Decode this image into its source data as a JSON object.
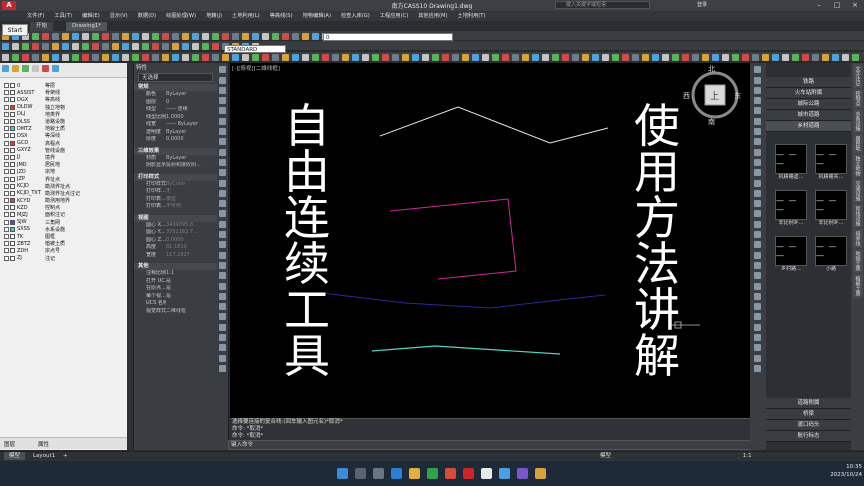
{
  "titlebar": {
    "title": "南方CASS10    Drawing1.dwg",
    "search_placeholder": "键入关键字或短语",
    "user": "登录"
  },
  "start_tooltip": "Start",
  "menu": [
    "文件(F)",
    "工具(T)",
    "编辑(E)",
    "显示(V)",
    "数据(D)",
    "绘图处理(W)",
    "地籍(J)",
    "土地利用(L)",
    "等高线(S)",
    "地物编辑(A)",
    "检查入库(G)",
    "工程应用(C)",
    "其他应用(M)",
    "土地利用(T)"
  ],
  "doc_tabs": [
    "开始",
    "Drawing1*"
  ],
  "toolbar": {
    "style_combo": "STANDARD",
    "layer_combo": "0"
  },
  "layers": [
    {
      "code": "0",
      "name": "等层",
      "color": "#ffffff"
    },
    {
      "code": "ASSIST",
      "name": "骨架线",
      "color": "#ffffff"
    },
    {
      "code": "DGX",
      "name": "等高线",
      "color": "#ffffff"
    },
    {
      "code": "DLDW",
      "name": "独立地物",
      "color": "#ff3030"
    },
    {
      "code": "DLJ",
      "name": "地类界",
      "color": "#ffffff"
    },
    {
      "code": "DLSS",
      "name": "道路设施",
      "color": "#ffffff"
    },
    {
      "code": "DMTZ",
      "name": "地貌土质",
      "color": "#2fd3d3"
    },
    {
      "code": "DSX",
      "name": "等深线",
      "color": "#ffffff"
    },
    {
      "code": "GCD",
      "name": "高程点",
      "color": "#ff3030"
    },
    {
      "code": "GXYZ",
      "name": "管线设施",
      "color": "#ffffff"
    },
    {
      "code": "JJ",
      "name": "境界",
      "color": "#ffffff"
    },
    {
      "code": "JMD",
      "name": "居民地",
      "color": "#ffffff"
    },
    {
      "code": "JZD",
      "name": "宗地",
      "color": "#ffffff"
    },
    {
      "code": "JZP",
      "name": "界址点",
      "color": "#ffffff"
    },
    {
      "code": "KCJD",
      "name": "勘测界址点",
      "color": "#ffffff"
    },
    {
      "code": "KCJD_TXT",
      "name": "勘测界址点注记",
      "color": "#ffffff"
    },
    {
      "code": "KCYD",
      "name": "勘测用地界",
      "color": "#ff3030"
    },
    {
      "code": "KZD",
      "name": "控制点",
      "color": "#ffffff"
    },
    {
      "code": "MJZJ",
      "name": "面积注记",
      "color": "#ffffff"
    },
    {
      "code": "SJW",
      "name": "三角网",
      "color": "#3050ff"
    },
    {
      "code": "SXSS",
      "name": "水系设施",
      "color": "#2fd3d3"
    },
    {
      "code": "TK",
      "name": "图框",
      "color": "#ffffff"
    },
    {
      "code": "ZBTZ",
      "name": "植被土质",
      "color": "#ffffff"
    },
    {
      "code": "ZDH",
      "name": "宗点号",
      "color": "#ffffff"
    },
    {
      "code": "ZJ",
      "name": "注记",
      "color": "#ffffff"
    }
  ],
  "layer_tabs": [
    "图层",
    "属性"
  ],
  "props": {
    "title": "特性",
    "selection": "无选择",
    "sections": [
      {
        "title": "常规",
        "rows": [
          [
            "颜色",
            "ByLayer"
          ],
          [
            "图层",
            "0"
          ],
          [
            "线型",
            "—— 连续"
          ],
          [
            "线型比例",
            "1.0000"
          ],
          [
            "线宽",
            "—— ByLayer"
          ],
          [
            "透明度",
            "ByLayer"
          ],
          [
            "厚度",
            "0.0000"
          ]
        ]
      },
      {
        "title": "三维效果",
        "rows": [
          [
            "材质",
            "ByLayer"
          ],
          [
            "阴影显示",
            "投射和接收阴..."
          ]
        ]
      },
      {
        "title": "打印样式",
        "rows": [
          [
            "打印样式",
            "ByColor"
          ],
          [
            "打印样...",
            "无"
          ],
          [
            "打印表...",
            "模型"
          ],
          [
            "打印表...",
            "不可用"
          ]
        ]
      },
      {
        "title": "视图",
        "rows": [
          [
            "圆心 X...",
            "3409095.8..."
          ],
          [
            "圆心 Y...",
            "3751162.7..."
          ],
          [
            "圆心 Z...",
            "0.0000"
          ],
          [
            "高度",
            "81.1819"
          ],
          [
            "宽度",
            "117.2827"
          ]
        ]
      },
      {
        "title": "其他",
        "rows": [
          [
            "注释比例",
            "1:1"
          ],
          [
            "打开 UC...",
            "是"
          ],
          [
            "在原点...",
            "是"
          ],
          [
            "每个视...",
            "是"
          ],
          [
            "UCS 名称",
            ""
          ],
          [
            "视觉样式",
            "二维线框"
          ]
        ]
      }
    ]
  },
  "canvas": {
    "view_label": "[-][俯视][二维线框]",
    "left_text": [
      "自",
      "由",
      "连",
      "续",
      "工",
      "具"
    ],
    "right_text": [
      "使",
      "用",
      "方",
      "法",
      "讲",
      "解"
    ],
    "compass": {
      "n": "北",
      "s": "南",
      "e": "东",
      "w": "西",
      "top": "上"
    }
  },
  "command": {
    "lines": [
      "选择要连接的复合线:(回车输入图元名)*取消*",
      "命令: *取消*",
      "命令: *取消*"
    ],
    "prompt": "键入命令"
  },
  "right_panel": {
    "top_items": [
      "铁路",
      "火车站附属",
      "城际公路",
      "城市道路",
      "乡村道路"
    ],
    "symbols": [
      [
        "机耕路虚...",
        "机耕路实..."
      ],
      [
        "非比例乡...",
        "非比例乡..."
      ],
      [
        "乡村路...",
        "小路"
      ]
    ],
    "bottom_items": [
      "道路附属",
      "桥梁",
      "渡口码头",
      "航行标志"
    ],
    "vertical_tabs": [
      "文字注记",
      "控制点",
      "水系设施",
      "居民地",
      "独立地物",
      "交通设施",
      "管线设施",
      "境界线",
      "地貌土质",
      "植被土质"
    ]
  },
  "layout_tabs": [
    "模型",
    "Layout1",
    "+"
  ],
  "status": {
    "mode": "模型",
    "scale": "1:1"
  },
  "clock": {
    "time": "10:35",
    "date": "2023/10/24"
  }
}
